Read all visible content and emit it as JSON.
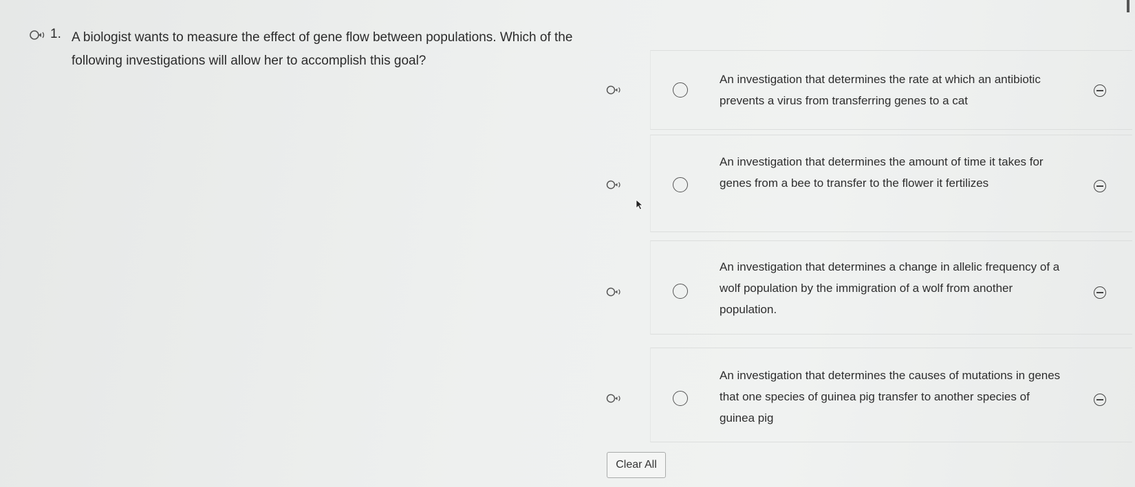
{
  "question": {
    "number": "1.",
    "text": "A biologist wants to measure the effect of gene flow between populations. Which of the following investigations will allow her to accomplish this goal?"
  },
  "choices": [
    {
      "text": "An investigation that determines the rate at which an antibiotic prevents a virus from transferring genes to a cat"
    },
    {
      "text": "An investigation that determines the amount of time it takes for genes from a bee to transfer to the flower it fertilizes"
    },
    {
      "text": "An investigation that determines a change in allelic frequency of a wolf population by the immigration of a wolf from another population."
    },
    {
      "text": "An investigation that determines the causes of mutations in genes that one species of guinea pig transfer to another species of guinea pig"
    }
  ],
  "buttons": {
    "clear_all": "Clear All"
  },
  "icons": {
    "speaker": "text-to-speech-icon",
    "eliminate": "eliminate-choice-icon",
    "radio": "radio-button"
  }
}
